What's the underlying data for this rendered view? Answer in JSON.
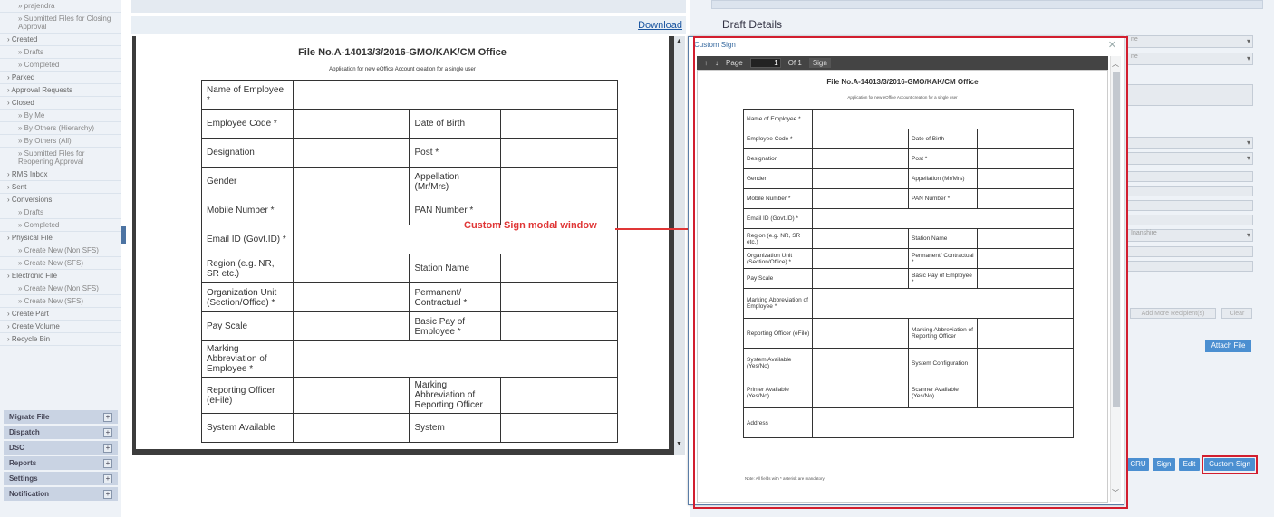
{
  "sidebar": {
    "items": [
      {
        "label": "» prajendra",
        "sub": true
      },
      {
        "label": "» Submitted Files for Closing Approval",
        "sub": true
      },
      {
        "label": "› Created",
        "sub": false
      },
      {
        "label": "» Drafts",
        "sub": true
      },
      {
        "label": "» Completed",
        "sub": true
      },
      {
        "label": "› Parked",
        "sub": false
      },
      {
        "label": "› Approval Requests",
        "sub": false
      },
      {
        "label": "› Closed",
        "sub": false
      },
      {
        "label": "» By Me",
        "sub": true
      },
      {
        "label": "» By Others (Hierarchy)",
        "sub": true
      },
      {
        "label": "» By Others (All)",
        "sub": true
      },
      {
        "label": "» Submitted Files for Reopening Approval",
        "sub": true
      },
      {
        "label": "› RMS Inbox",
        "sub": false
      },
      {
        "label": "› Sent",
        "sub": false
      },
      {
        "label": "› Conversions",
        "sub": false
      },
      {
        "label": "» Drafts",
        "sub": true
      },
      {
        "label": "» Completed",
        "sub": true
      },
      {
        "label": "› Physical File",
        "sub": false
      },
      {
        "label": "» Create New (Non SFS)",
        "sub": true
      },
      {
        "label": "» Create New (SFS)",
        "sub": true
      },
      {
        "label": "› Electronic File",
        "sub": false
      },
      {
        "label": "» Create New (Non SFS)",
        "sub": true
      },
      {
        "label": "» Create New (SFS)",
        "sub": true
      },
      {
        "label": "› Create Part",
        "sub": false
      },
      {
        "label": "› Create Volume",
        "sub": false
      },
      {
        "label": "› Recycle Bin",
        "sub": false
      }
    ],
    "sections": [
      "Migrate File",
      "Dispatch",
      "DSC",
      "Reports",
      "Settings",
      "Notification"
    ]
  },
  "content": {
    "download_label": "Download",
    "doc_title": "File No.A-14013/3/2016-GMO/KAK/CM Office",
    "doc_subtitle": "Application for new eOffice Account creation for a single user",
    "annotation": "Custom Sign modal window",
    "rows": [
      {
        "a": "Name of Employee *",
        "b": "",
        "c": "",
        "d": ""
      },
      {
        "a": "Employee Code *",
        "b": "",
        "c": "Date of Birth",
        "d": ""
      },
      {
        "a": "Designation",
        "b": "",
        "c": "Post *",
        "d": ""
      },
      {
        "a": "Gender",
        "b": "",
        "c": "Appellation (Mr/Mrs)",
        "d": ""
      },
      {
        "a": "Mobile Number *",
        "b": "",
        "c": "PAN Number *",
        "d": ""
      },
      {
        "a": "Email ID (Govt.ID) *",
        "b": "",
        "c": "",
        "d": ""
      },
      {
        "a": "Region (e.g. NR, SR etc.)",
        "b": "",
        "c": "Station Name",
        "d": ""
      },
      {
        "a": "Organization Unit (Section/Office) *",
        "b": "",
        "c": "Permanent/ Contractual *",
        "d": ""
      },
      {
        "a": "Pay Scale",
        "b": "",
        "c": "Basic Pay of Employee *",
        "d": ""
      },
      {
        "a": "Marking Abbreviation of Employee *",
        "b": "",
        "c": "",
        "d": ""
      },
      {
        "a": "Reporting Officer (eFile)",
        "b": "",
        "c": "Marking Abbreviation of Reporting Officer",
        "d": ""
      },
      {
        "a": "System Available",
        "b": "",
        "c": "System",
        "d": ""
      }
    ]
  },
  "modal": {
    "title": "Custom Sign",
    "page_label": "Page",
    "page_value": "1",
    "of_label": "Of 1",
    "sign_label": "Sign",
    "doc_title": "File No.A-14013/3/2016-GMO/KAK/CM Office",
    "doc_subtitle": "Application for new eOffice Account creation for a single user",
    "rows": [
      {
        "a": "Name of Employee *",
        "c": ""
      },
      {
        "a": "Employee Code *",
        "c": "Date of Birth"
      },
      {
        "a": "Designation",
        "c": "Post *"
      },
      {
        "a": "Gender",
        "c": "Appellation (Mr/Mrs)"
      },
      {
        "a": "Mobile Number *",
        "c": "PAN Number *"
      },
      {
        "a": "Email ID (Govt.ID) *",
        "c": ""
      },
      {
        "a": "Region (e.g. NR, SR etc.)",
        "c": "Station Name"
      },
      {
        "a": "Organization Unit (Section/Office) *",
        "c": "Permanent/ Contractual *"
      },
      {
        "a": "Pay Scale",
        "c": "Basic Pay of Employee *"
      },
      {
        "a": "Marking Abbreviation of Employee *",
        "c": ""
      },
      {
        "a": "Reporting Officer (eFile)",
        "c": "Marking Abbreviation of Reporting Officer"
      },
      {
        "a": "System Available (Yes/No)",
        "c": "System Configuration"
      },
      {
        "a": "Printer Available (Yes/No)",
        "c": "Scanner Available (Yes/No)"
      },
      {
        "a": "Address",
        "c": ""
      }
    ],
    "footnote": "Note: All fields with * asterisk are mandatory"
  },
  "right_panel": {
    "title": "Draft Details",
    "fields": [
      "ne",
      "ne",
      "",
      "",
      "",
      "",
      "",
      "",
      "",
      "",
      "Inanshire",
      "",
      ""
    ],
    "add_more": "Add More Recipient(s)",
    "clear": "Clear",
    "attach": "Attach File",
    "actions": [
      "CRU",
      "Sign",
      "Edit",
      "Custom Sign"
    ]
  }
}
